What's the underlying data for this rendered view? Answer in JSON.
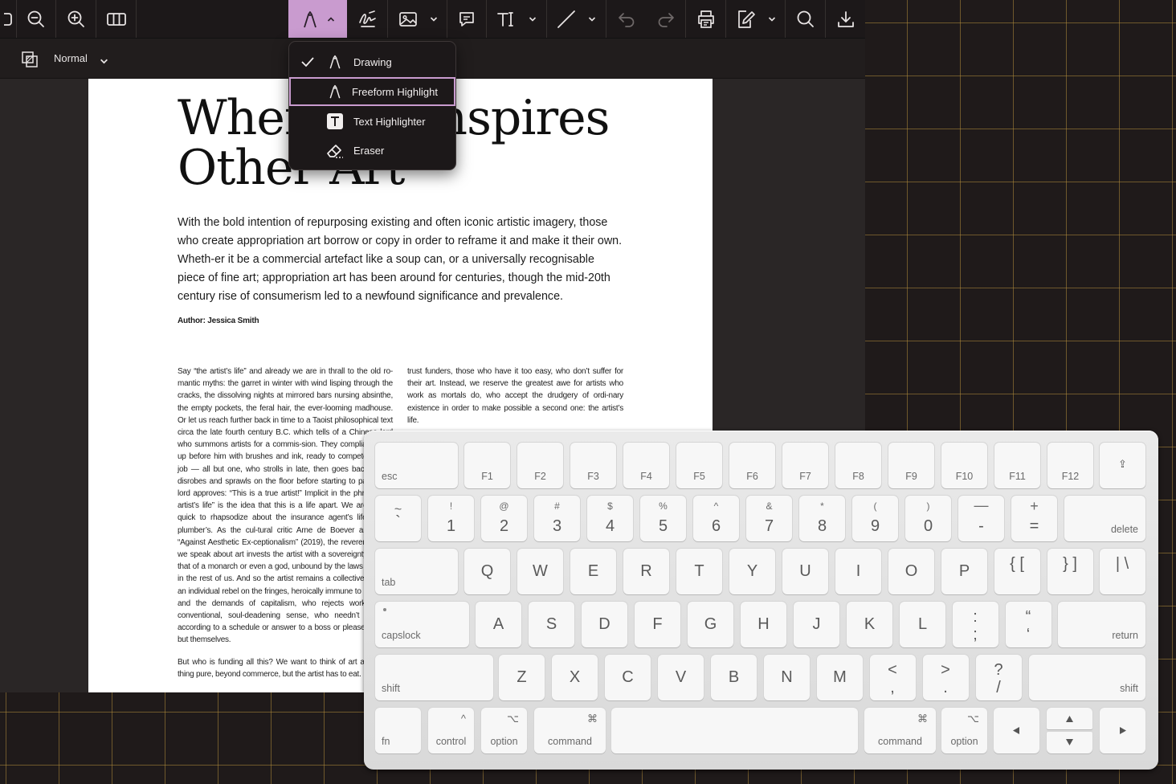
{
  "toolbar": {
    "buttons": [
      "zoom-out",
      "zoom-in",
      "page-layout",
      "annotate-pen",
      "signature",
      "image",
      "comment",
      "text-tool",
      "line-tool",
      "undo",
      "redo",
      "print",
      "edit-form",
      "search",
      "download"
    ],
    "active": "annotate-pen",
    "accent": "#c99bcf"
  },
  "subbar": {
    "blend_mode": "Normal"
  },
  "dropdown": {
    "items": [
      {
        "label": "Drawing",
        "icon": "pen-nib-icon",
        "checked": true
      },
      {
        "label": "Freeform Highlight",
        "icon": "highlighter-icon",
        "selected": true
      },
      {
        "label": "Text Highlighter",
        "icon": "text-box-icon"
      },
      {
        "label": "Eraser",
        "icon": "eraser-icon"
      }
    ]
  },
  "document": {
    "title_line1": "When Art Inspires",
    "title_line2": "Other Art",
    "lead": "With the bold intention of repurposing existing and often iconic artistic imagery, those who create appropriation art borrow or copy in order to reframe it and make it their own. Wheth-er it be a commercial artefact like a soup can, or a universally recognisable piece of fine art; appropriation art has been around for centuries, though the mid-20th century rise of consumerism led to a newfound significance and prevalence.",
    "author": "Author: Jessica Smith",
    "col1_p1": "Say “the artist’s life” and already we are in thrall to the old ro-mantic myths: the garret in winter with wind lisping through the cracks, the dissolving nights at mirrored bars nursing absinthe, the empty pockets, the feral hair, the ever-looming madhouse. Or let us reach further back in time to a Taoist philosophical text circa the late fourth century B.C. which tells of a Chinese lord who summons artists for a commis-sion. They compliantly line up before him with brushes and ink, ready to compete for the job — all but one, who strolls in late, then goes back home, disrobes and sprawls on the floor before starting to paint. The lord approves: “This is a true artist!” Implicit in the phrase “the artist’s life” is the idea that this is a life apart. We are not so quick to rhapsodize about the insurance agent’s life or the plumber’s. As the cul-tural critic Arne de Boever argues in “Against Aesthetic Ex-ceptionalism” (2019), the reverential way we speak about art invests the artist with a sovereignty akin to that of a monarch or even a god, unbound by the laws that rein in the rest of us. And so the artist remains a collective fantasy, an individual rebel on the fringes, heroically immune to propriety and the demands of capitalism, who rejects work in the conventional, soul-deadening sense, who needn’t produce according to a schedule or answer to a boss or please anyone but themselves.",
    "col1_p2": "But who is funding all this? We want to think of art as some-thing pure, beyond commerce, but the artist has to eat.",
    "col2_p1": "trust  funders, those who have it too easy, who don’t suffer for their art. Instead, we reserve the greatest awe for artists who work as mortals do, who accept the drudgery of ordi-nary existence in order to make possible a second one: the artist’s life."
  },
  "keyboard": {
    "row0": [
      "esc",
      "F1",
      "F2",
      "F3",
      "F4",
      "F5",
      "F6",
      "F7",
      "F8",
      "F9",
      "F10",
      "F11",
      "F12",
      "⇪"
    ],
    "row1": [
      {
        "t": "~",
        "b": "`"
      },
      {
        "t": "!",
        "b": "1"
      },
      {
        "t": "@",
        "b": "2"
      },
      {
        "t": "#",
        "b": "3"
      },
      {
        "t": "$",
        "b": "4"
      },
      {
        "t": "%",
        "b": "5"
      },
      {
        "t": "^",
        "b": "6"
      },
      {
        "t": "&",
        "b": "7"
      },
      {
        "t": "*",
        "b": "8"
      },
      {
        "t": "(",
        "b": "9"
      },
      {
        "t": ")",
        "b": "0"
      },
      {
        "t": "—",
        "b": "-"
      },
      {
        "t": "+",
        "b": "="
      },
      {
        "t": "",
        "b": "delete"
      }
    ],
    "row2": [
      "tab",
      "Q",
      "W",
      "E",
      "R",
      "T",
      "Y",
      "U",
      "I",
      "O",
      "P",
      "{ [",
      "} ]",
      "| \\"
    ],
    "row3": [
      "capslock",
      "A",
      "S",
      "D",
      "F",
      "G",
      "H",
      "J",
      "K",
      "L",
      ": ;",
      "“ ‘",
      "return"
    ],
    "row4": [
      "shift",
      "Z",
      "X",
      "C",
      "V",
      "B",
      "N",
      "M",
      "< ,",
      "> .",
      "? /",
      "shift"
    ],
    "row5": [
      "fn",
      "control",
      "option",
      "command",
      "",
      "command",
      "option"
    ],
    "mods": {
      "control": "^",
      "option": "⌥",
      "command": "⌘"
    }
  }
}
